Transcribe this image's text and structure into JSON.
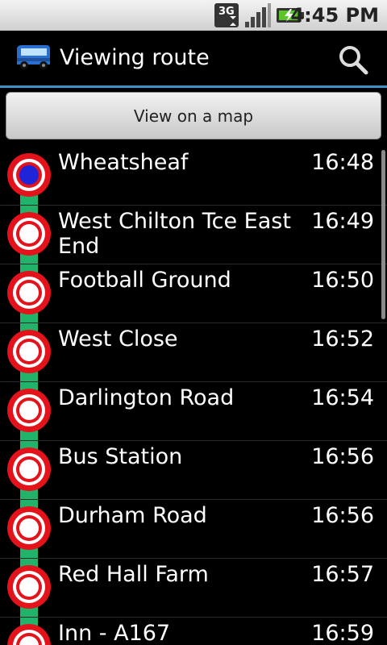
{
  "status_bar": {
    "network_type": "3G",
    "time": "4:45 PM",
    "icons": [
      "3g-icon",
      "signal-icon",
      "battery-charging-icon"
    ]
  },
  "header": {
    "title": "Viewing route",
    "icons": [
      "bus-icon",
      "search-icon"
    ]
  },
  "map_button": {
    "label": "View on a map"
  },
  "colors": {
    "accent_line": "#3f8fc8",
    "route_line": "#22b36a",
    "stop_ring": "#e3121b",
    "current_stop": "#1f24d8"
  },
  "stops": [
    {
      "name": "Wheatsheaf",
      "time": "16:48",
      "current": true
    },
    {
      "name": "West Chilton Tce East End",
      "time": "16:49",
      "current": false
    },
    {
      "name": "Football Ground",
      "time": "16:50",
      "current": false
    },
    {
      "name": "West Close",
      "time": "16:52",
      "current": false
    },
    {
      "name": "Darlington Road",
      "time": "16:54",
      "current": false
    },
    {
      "name": "Bus Station",
      "time": "16:56",
      "current": false
    },
    {
      "name": "Durham Road",
      "time": "16:56",
      "current": false
    },
    {
      "name": "Red Hall Farm",
      "time": "16:57",
      "current": false
    },
    {
      "name": "Inn - A167",
      "time": "16:59",
      "current": false
    }
  ]
}
